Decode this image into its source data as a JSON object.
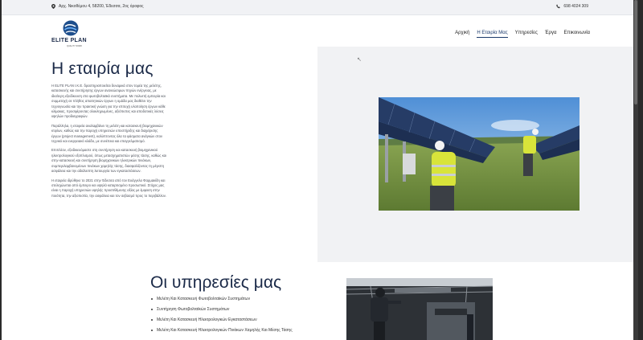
{
  "topbar": {
    "address": "Αρχ. Νικοθέμου 4, 58200, Έδεσσα, 2ος όροφος",
    "phone": "698 4024 309"
  },
  "header": {
    "logo_name": "ELITE PLAN",
    "logo_tagline": "QUALITY WORK",
    "nav": [
      {
        "label": "Αρχική"
      },
      {
        "label": "Η Εταιρία Μας"
      },
      {
        "label": "Υπηρεσίες"
      },
      {
        "label": "Έργα"
      },
      {
        "label": "Επικοινωνία"
      }
    ]
  },
  "about": {
    "title": "Η εταιρία μας",
    "paragraphs": [
      "Η ELITE PLAN I.K.E. δραστηριοποιείται δυναμικά στον τομέα της μελέτης, κατασκευής και συντήρησης έργων ανανεώσιμων πηγών ενέργειας, με ιδιαίτερη εξειδίκευση στα φωτοβολταϊκά συστήματα. Με πολυετή εμπειρία και συμμετοχή σε πλήθος απαιτητικών έργων η ομάδα μας διαθέτει την τεχνογνωσία και την πρακτική γνώση για την επιτυχή υλοποίηση έργων κάθε κλίμακας, προσφέροντας ολοκληρωμένες, αξιόπιστες και αποδοτικές λύσεις υψηλών προδιαγραφών.",
      "Παράλληλα, η εταιρεία αναλαμβάνει τη μελέτη και κατασκευή βιομηχανικών κτιρίων, καθώς και την παροχή υπηρεσιών υποστήριξης και διαχείρισης έργων (project management), καλύπτοντας όλα τα φάσματα ανάγκών στον τεχνικό και ενεργειακό κλάδο, με συνέπεια και επαγγελματισμό.",
      "Επιπλέον, εξειδικευόμαστε στη συντήρηση και κατασκευή βιομηχανικού ηλεκτρολογικού εξοπλισμού, όπως μετασχηματιστών μέσης τάσης, καθώς και στην κατασκευή και συντήρηση βιομηχανικών ηλεκτρικών πινάκων, συμπεριλαμβανομένων πινάκων χαμηλής τάσης, διασφαλίζοντας τη μέγιστη ασφάλεια και την αδιάλειπτη λειτουργία των εγκαταστάσεων.",
      "Η εταιρεία ιδρύθηκε το 2021 στην Έδεσσα από τον Ευάγγελο Φαρμακίδη και στελεχώνεται από έμπειρο και υψηλά καταρτισμένο προσωπικό. Στόχος μας είναι η παροχή υπηρεσιών υψηλής προστιθέμενης αξίας με έμφαση στην ποιότητα, την αξιοπιστία, την ασφάλεια και τον σεβασμό προς το περιβάλλον."
    ]
  },
  "services": {
    "title": "Οι υπηρεσίες μας",
    "items": [
      {
        "label": "Μελέτη Και Κατασκευή Φωτοβολταϊκών Συστημάτων"
      },
      {
        "label": "Συντήρηση Φωτοβολταϊκών Συστημάτων"
      },
      {
        "label": "Μελέτη Και Κατασκευή Ηλεκτρολογικών Εγκαταστάσεων"
      },
      {
        "label": "Μελέτη Και Κατασκευή Ηλεκτρολογικών Πινάκων Χαμηλής Και Μέσης Τάσης"
      }
    ]
  },
  "colors": {
    "heading": "#1b2a48",
    "accent": "#1b3a6b",
    "panel": "#f1f2f4",
    "topbar": "#f1f2f5"
  }
}
